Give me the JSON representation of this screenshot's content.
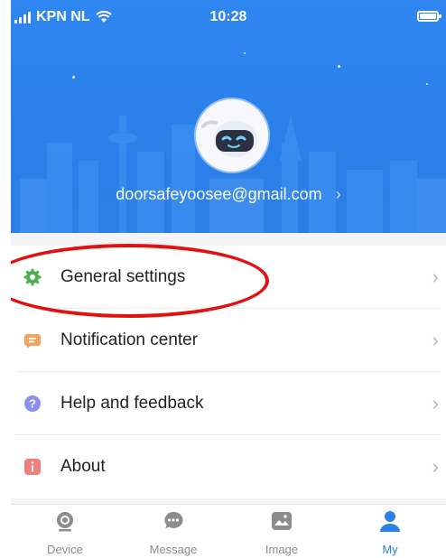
{
  "status_bar": {
    "carrier": "KPN NL",
    "time": "10:28"
  },
  "profile": {
    "email": "doorsafeyoosee@gmail.com",
    "chevron": "›"
  },
  "menu": {
    "items": [
      {
        "label": "General settings",
        "icon": "gear-icon",
        "color": "#4caf50"
      },
      {
        "label": "Notification center",
        "icon": "notification-icon",
        "color": "#f5a25d"
      },
      {
        "label": "Help and feedback",
        "icon": "help-icon",
        "color": "#8d8ef0"
      },
      {
        "label": "About",
        "icon": "info-icon",
        "color": "#f08080"
      }
    ],
    "chevron": "›"
  },
  "tabbar": {
    "tabs": [
      {
        "label": "Device",
        "icon": "camera-icon",
        "active": false
      },
      {
        "label": "Message",
        "icon": "message-icon",
        "active": false
      },
      {
        "label": "Image",
        "icon": "image-icon",
        "active": false
      },
      {
        "label": "My",
        "icon": "person-icon",
        "active": true
      }
    ]
  },
  "colors": {
    "accent": "#2b7fe6",
    "highlight": "#e21010"
  }
}
